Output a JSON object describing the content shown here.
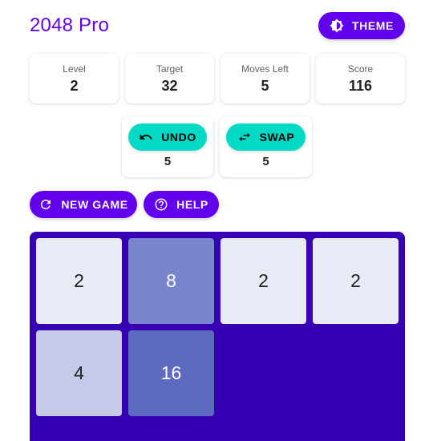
{
  "header": {
    "title": "2048 Pro",
    "theme_label": "THEME"
  },
  "stats": [
    {
      "label": "Level",
      "value": "2"
    },
    {
      "label": "Target",
      "value": "32"
    },
    {
      "label": "Moves Left",
      "value": "5"
    },
    {
      "label": "Score",
      "value": "116"
    }
  ],
  "tools": {
    "undo": {
      "label": "UNDO",
      "count": "5"
    },
    "swap": {
      "label": "SWAP",
      "count": "5"
    }
  },
  "actions": {
    "new_game_label": "NEW GAME",
    "help_label": "HELP"
  },
  "board": {
    "tiles": [
      {
        "value": "2",
        "bg": "#e8eaf6",
        "fg": "#212121"
      },
      {
        "value": "8",
        "bg": "#7986cb",
        "fg": "#ffffff"
      },
      {
        "value": "2",
        "bg": "#e8eaf6",
        "fg": "#212121"
      },
      {
        "value": "2",
        "bg": "#e8eaf6",
        "fg": "#212121"
      },
      {
        "value": "4",
        "bg": "#c5cae9",
        "fg": "#212121"
      },
      {
        "value": "16",
        "bg": "#5c6bc0",
        "fg": "#ffffff"
      }
    ]
  },
  "colors": {
    "primary": "#6200ee",
    "secondary": "#03dac5",
    "board": "#3700b3"
  }
}
